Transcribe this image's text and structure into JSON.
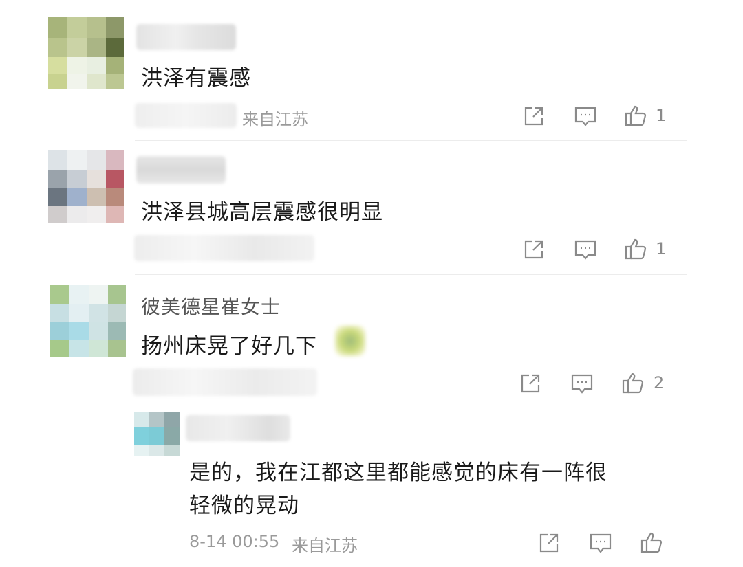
{
  "comments": [
    {
      "text": "洪泽有震感",
      "location": "来自江苏",
      "like_count": "1"
    },
    {
      "text": "洪泽县城高层震感很明显",
      "like_count": "1"
    },
    {
      "username": "彼美德星崔女士",
      "text": "扬州床晃了好几下",
      "like_count": "2"
    }
  ],
  "reply": {
    "text_line1": "是的，我在江都这里都能感觉的床有一阵很",
    "text_line2": "轻微的晃动",
    "time": "8-14 00:55",
    "location": "来自江苏"
  },
  "icons": {
    "share": "share-icon",
    "comment": "comment-icon",
    "like": "thumbs-up-icon"
  },
  "colors": {
    "text": "#1a1a1a",
    "meta": "#9a9a9a",
    "icon": "#8a8a8a",
    "divider": "#ececec"
  }
}
